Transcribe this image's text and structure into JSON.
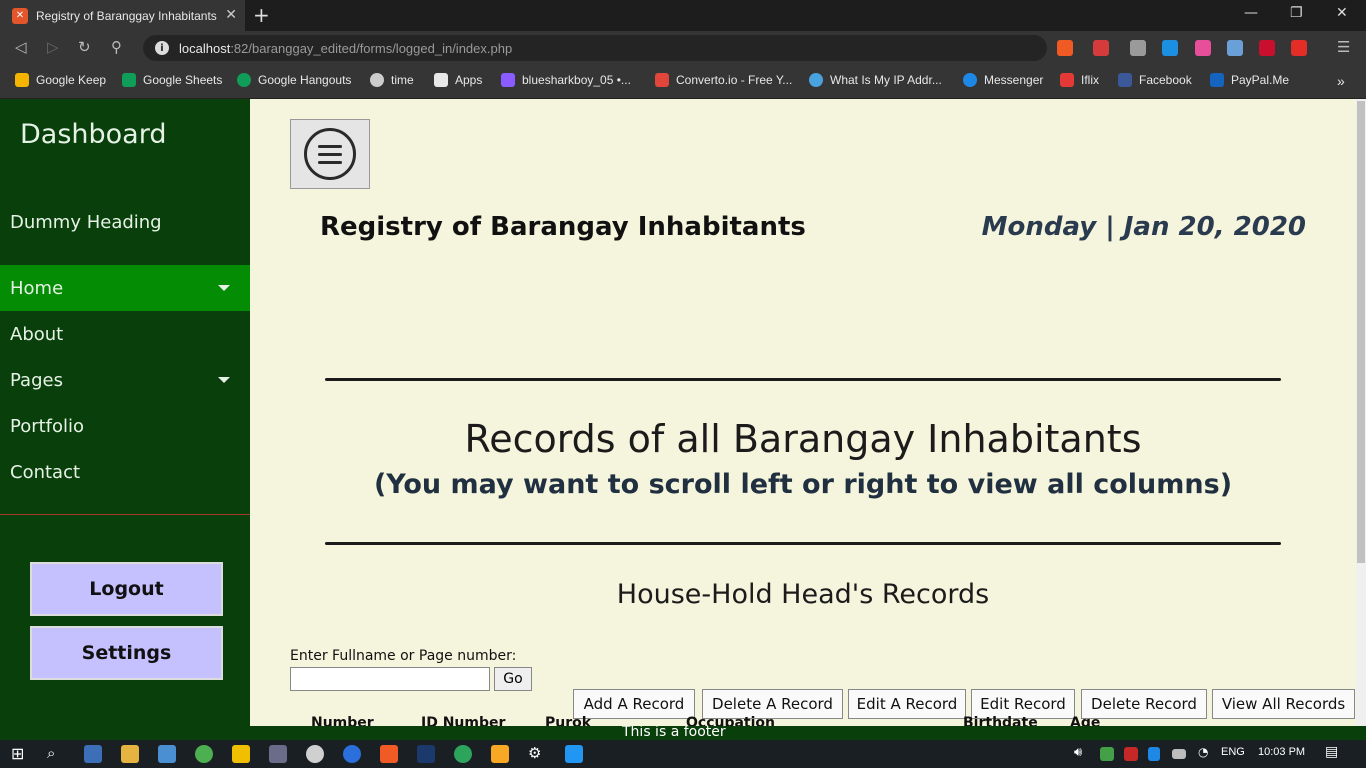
{
  "browser": {
    "tab_title": "Registry of Baranggay Inhabitants",
    "tab_favicon": "xampp-icon",
    "url_host": "localhost",
    "url_path": ":82/baranggay_edited/forms/logged_in/index.php",
    "bookmarks": [
      {
        "label": "Google Keep",
        "color": "#f4b400"
      },
      {
        "label": "Google Sheets",
        "color": "#0f9d58"
      },
      {
        "label": "Google Hangouts",
        "color": "#0f9d58"
      },
      {
        "label": "time",
        "color": "#cccccc"
      },
      {
        "label": "Apps",
        "color": "#e8e8e8"
      },
      {
        "label": "bluesharkboy_05 •...",
        "color": "#8a5cff"
      },
      {
        "label": "Converto.io - Free Y...",
        "color": "#e0463a"
      },
      {
        "label": "What Is My IP Addr...",
        "color": "#4aa3df"
      },
      {
        "label": "Messenger",
        "color": "#1e88e5"
      },
      {
        "label": "Iflix",
        "color": "#e53935"
      },
      {
        "label": "Facebook",
        "color": "#3b5998"
      },
      {
        "label": "PayPal.Me",
        "color": "#1565c0"
      }
    ]
  },
  "sidebar": {
    "title": "Dashboard",
    "heading": "Dummy Heading",
    "items": [
      {
        "label": "Home",
        "active": true,
        "has_caret": true
      },
      {
        "label": "About",
        "active": false,
        "has_caret": false
      },
      {
        "label": "Pages",
        "active": false,
        "has_caret": true
      },
      {
        "label": "Portfolio",
        "active": false,
        "has_caret": false
      },
      {
        "label": "Contact",
        "active": false,
        "has_caret": false
      }
    ],
    "logout_label": "Logout",
    "settings_label": "Settings"
  },
  "main": {
    "registry_title": "Registry of Barangay Inhabitants",
    "date": "Monday | Jan 20, 2020",
    "records_title": "Records of all Barangay Inhabitants",
    "records_subtitle": "(You may want to scroll left or right to view all columns)",
    "household_title": "House-Hold Head's Records",
    "search_label": "Enter Fullname or Page number:",
    "search_value": "",
    "go_label": "Go",
    "actions": [
      "Add A Record",
      "Delete A Record",
      "Edit A Record",
      "Edit Record",
      "Delete Record",
      "View All Records"
    ],
    "table_headers": [
      "Number",
      "ID Number",
      "Purok",
      "Occupation",
      "Birthdate",
      "Age"
    ],
    "footer_text": "This is a footer"
  },
  "taskbar": {
    "language": "ENG",
    "time": "10:03 PM"
  }
}
